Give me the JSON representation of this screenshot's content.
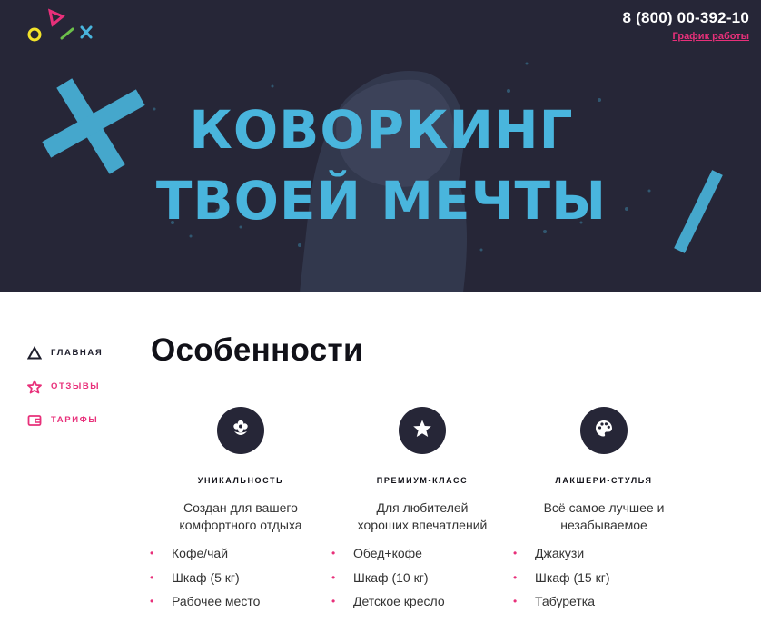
{
  "header": {
    "phone": "8 (800) 00-392-10",
    "schedule_link": "График работы"
  },
  "hero": {
    "headline_line1": "КОВОРКИНГ",
    "headline_line2": "ТВОЕЙ МЕЧТЫ"
  },
  "colors": {
    "dark": "#262637",
    "accent_pink": "#e8307a",
    "accent_blue": "#49b5dd",
    "logo_yellow": "#f2e32a",
    "logo_green": "#6cc04a"
  },
  "nav": {
    "items": [
      {
        "label": "ГЛАВНАЯ",
        "icon": "triangle-icon"
      },
      {
        "label": "ОТЗЫВЫ",
        "icon": "star-icon"
      },
      {
        "label": "ТАРИФЫ",
        "icon": "wallet-icon"
      }
    ]
  },
  "main": {
    "title": "Особенности",
    "features": [
      {
        "icon": "flower-icon",
        "title": "УНИКАЛЬНОСТЬ",
        "desc_line1": "Создан для вашего",
        "desc_line2": "комфортного отдыха",
        "items": [
          "Кофе/чай",
          "Шкаф (5 кг)",
          "Рабочее место"
        ]
      },
      {
        "icon": "star-icon",
        "title": "ПРЕМИУМ-КЛАСС",
        "desc_line1": "Для любителей",
        "desc_line2": "хороших впечатлений",
        "items": [
          "Обед+кофе",
          "Шкаф (10 кг)",
          "Детское кресло"
        ]
      },
      {
        "icon": "palette-icon",
        "title": "ЛАКШЕРИ-СТУЛЬЯ",
        "desc_line1": "Всё самое лучшее и",
        "desc_line2": "незабываемое",
        "items": [
          "Джакузи",
          "Шкаф (15 кг)",
          "Табуретка"
        ]
      }
    ]
  }
}
